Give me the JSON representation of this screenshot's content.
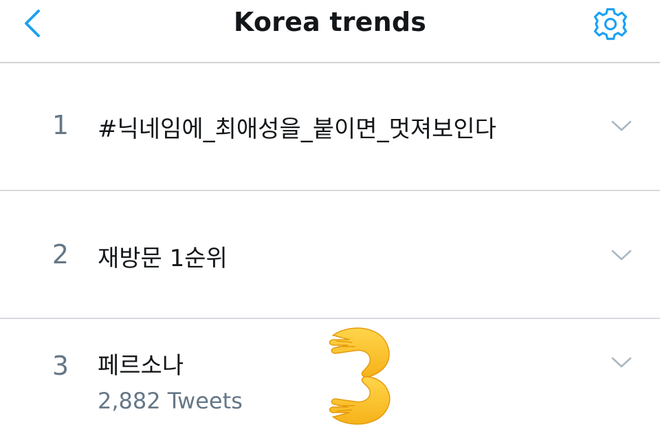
{
  "header": {
    "title": "Korea trends",
    "back_icon": "chevron-left-icon",
    "settings_icon": "gear-icon"
  },
  "trends": [
    {
      "rank": "1",
      "name": "#닉네임에_최애성을_붙이면_멋져보인다",
      "tweets": ""
    },
    {
      "rank": "2",
      "name": "재방문 1순위",
      "tweets": ""
    },
    {
      "rank": "3",
      "name": "페르소나",
      "tweets": "2,882 Tweets"
    }
  ],
  "overlay": {
    "emoji": "hands-3-emoji"
  },
  "colors": {
    "accent": "#1da1f2",
    "title_text": "#14171a",
    "secondary_text": "#657786",
    "divider": "#d7dadd",
    "chevron": "#aab8c2",
    "emoji_yellow": "#fbc02d"
  }
}
